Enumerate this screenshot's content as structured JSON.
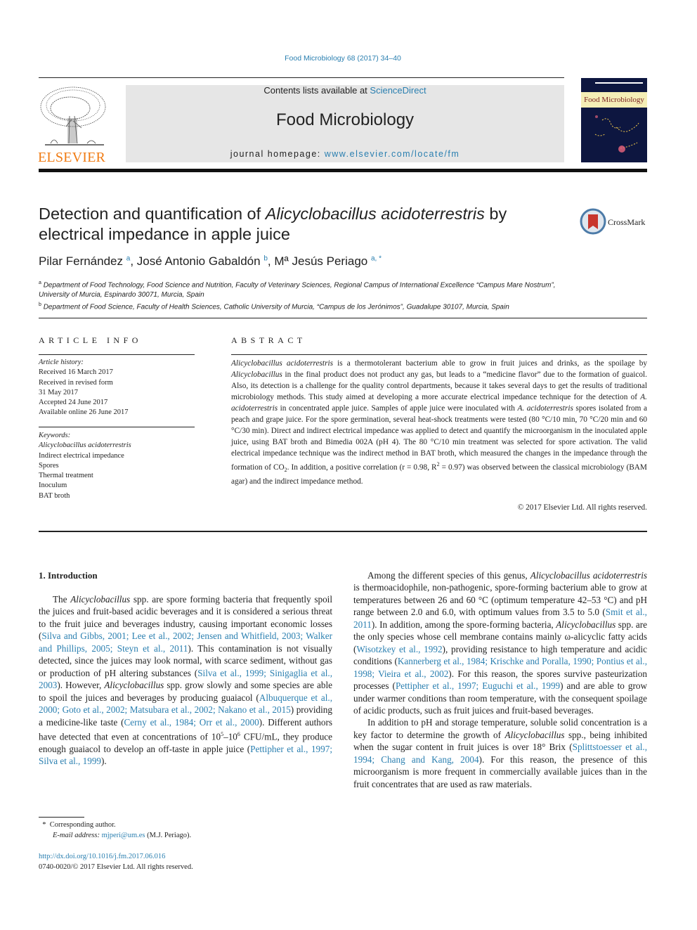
{
  "header": {
    "journal_ref": "Food Microbiology 68 (2017) 34–40",
    "contents_prefix": "Contents lists available at ",
    "contents_link": "ScienceDirect",
    "journal_name": "Food Microbiology",
    "homepage_prefix": "journal homepage: ",
    "homepage_link": "www.elsevier.com/locate/fm",
    "publisher_logo_text": "ELSEVIER",
    "cover_title": "Food Microbiology",
    "brand_color": "#f07b13",
    "link_color": "#2a7fb0"
  },
  "article": {
    "title_part1": "Detection and quantification of ",
    "title_italic": "Alicyclobacillus acidoterrestris",
    "title_part2": " by electrical impedance in apple juice",
    "crossmark_label": "CrossMark",
    "authors": [
      {
        "name": "Pilar Fernández",
        "aff": "a"
      },
      {
        "name": "José Antonio Gabaldón",
        "aff": "b"
      },
      {
        "name": "Mª Jesús Periago",
        "aff": "a, *"
      }
    ],
    "affiliations": [
      {
        "mark": "a",
        "text": "Department of Food Technology, Food Science and Nutrition, Faculty of Veterinary Sciences, Regional Campus of International Excellence “Campus Mare Nostrum”, University of Murcia, Espinardo 30071, Murcia, Spain"
      },
      {
        "mark": "b",
        "text": "Department of Food Science, Faculty of Health Sciences, Catholic University of Murcia, “Campus de los Jerónimos”, Guadalupe 30107, Murcia, Spain"
      }
    ]
  },
  "article_info": {
    "heading": "ARTICLE INFO",
    "history_label": "Article history:",
    "history": [
      "Received 16 March 2017",
      "Received in revised form",
      "31 May 2017",
      "Accepted 24 June 2017",
      "Available online 26 June 2017"
    ],
    "keywords_label": "Keywords:",
    "keywords": [
      "Alicyclobacillus acidoterrestris",
      "Indirect electrical impedance",
      "Spores",
      "Thermal treatment",
      "Inoculum",
      "BAT broth"
    ]
  },
  "abstract": {
    "heading": "ABSTRACT",
    "segments": [
      {
        "t": "Alicyclobacillus acidoterrestris",
        "i": true
      },
      {
        "t": " is a thermotolerant bacterium able to grow in fruit juices and drinks, as the spoilage by "
      },
      {
        "t": "Alicyclobacillus",
        "i": true
      },
      {
        "t": " in the final product does not product any gas, but leads to a “medicine flavor” due to the formation of guaicol. Also, its detection is a challenge for the quality control departments, because it takes several days to get the results of traditional microbiology methods. This study aimed at developing a more accurate electrical impedance technique for the detection of "
      },
      {
        "t": "A. acidoterrestris",
        "i": true
      },
      {
        "t": " in concentrated apple juice. Samples of apple juice were inoculated with "
      },
      {
        "t": "A. acidoterrestris",
        "i": true
      },
      {
        "t": " spores isolated from a peach and grape juice. For the spore germination, several heat-shock treatments were tested (80 °C/10 min, 70 °C/20 min and 60 °C/30 min). Direct and indirect electrical impedance was applied to detect and quantify the microorganism in the inoculated apple juice, using BAT broth and Bimedia 002A (pH 4). The 80 °C/10 min treatment was selected for spore activation. The valid electrical impedance technique was the indirect method in BAT broth, which measured the changes in the impedance through the formation of CO"
      },
      {
        "t": "2",
        "sub": true
      },
      {
        "t": ". In addition, a positive correlation (r = 0.98, R"
      },
      {
        "t": "2",
        "sup": true
      },
      {
        "t": " = 0.97) was observed between the classical microbiology (BAM agar) and the indirect impedance method."
      }
    ],
    "copyright": "© 2017 Elsevier Ltd. All rights reserved."
  },
  "body": {
    "section_heading": "1.  Introduction",
    "left_paragraphs": [
      [
        {
          "t": "The "
        },
        {
          "t": "Alicyclobacillus",
          "i": true
        },
        {
          "t": " spp. are spore forming bacteria that frequently spoil the juices and fruit-based acidic beverages and it is considered a serious threat to the fruit juice and beverages industry, causing important economic losses ("
        },
        {
          "t": "Silva and Gibbs, 2001; Lee et al., 2002; Jensen and Whitfield, 2003; Walker and Phillips, 2005; Steyn et al., 2011",
          "l": true
        },
        {
          "t": "). This contamination is not visually detected, since the juices may look normal, with scarce sediment, without gas or production of pH altering substances ("
        },
        {
          "t": "Silva et al., 1999; Sinigaglia et al., 2003",
          "l": true
        },
        {
          "t": "). However, "
        },
        {
          "t": "Alicyclobacillus",
          "i": true
        },
        {
          "t": " spp. grow slowly and some species are able to spoil the juices and beverages by producing guaiacol ("
        },
        {
          "t": "Albuquerque et al., 2000; Goto et al., 2002; Matsubara et al., 2002; Nakano et al., 2015",
          "l": true
        },
        {
          "t": ") providing a medicine-like taste ("
        },
        {
          "t": "Cerny et al., 1984; Orr et al., 2000",
          "l": true
        },
        {
          "t": "). Different authors have detected that even at concentrations of 10"
        },
        {
          "t": "5",
          "sup": true
        },
        {
          "t": "–10"
        },
        {
          "t": "6",
          "sup": true
        },
        {
          "t": " CFU/mL, they produce enough guaiacol to develop an off-taste in apple juice ("
        },
        {
          "t": "Pettipher et al., 1997; Silva et al., 1999",
          "l": true
        },
        {
          "t": ")."
        }
      ]
    ],
    "right_paragraphs": [
      [
        {
          "t": "Among the different species of this genus, "
        },
        {
          "t": "Alicyclobacillus acidoterrestris",
          "i": true
        },
        {
          "t": " is thermoacidophile, non-pathogenic, spore-forming bacterium able to grow at temperatures between 26 and 60 °C (optimum temperature 42–53 °C) and pH range between 2.0 and 6.0, with optimum values from 3.5 to 5.0 ("
        },
        {
          "t": "Smit et al., 2011",
          "l": true
        },
        {
          "t": "). In addition, among the spore-forming bacteria, "
        },
        {
          "t": "Alicyclobacillus",
          "i": true
        },
        {
          "t": " spp. are the only species whose cell membrane contains mainly ω-alicyclic fatty acids ("
        },
        {
          "t": "Wisotzkey et al., 1992",
          "l": true
        },
        {
          "t": "), providing resistance to high temperature and acidic conditions ("
        },
        {
          "t": "Kannerberg et al., 1984; Krischke and Poralla, 1990; Pontius et al., 1998; Vieira et al., 2002",
          "l": true
        },
        {
          "t": "). For this reason, the spores survive pasteurization processes ("
        },
        {
          "t": "Pettipher et al., 1997; Euguchi et al., 1999",
          "l": true
        },
        {
          "t": ") and are able to grow under warmer conditions than room temperature, with the consequent spoilage of acidic products, such as fruit juices and fruit-based beverages."
        }
      ],
      [
        {
          "t": "In addition to pH and storage temperature, soluble solid concentration is a key factor to determine the growth of "
        },
        {
          "t": "Alicyclobacillus",
          "i": true
        },
        {
          "t": " spp., being inhibited when the sugar content in fruit juices is over 18° Brix ("
        },
        {
          "t": "Splittstoesser et al., 1994; Chang and Kang, 2004",
          "l": true
        },
        {
          "t": "). For this reason, the presence of this microorganism is more frequent in commercially available juices than in the fruit concentrates that are used as raw materials."
        }
      ]
    ]
  },
  "footnotes": {
    "corresponding_mark": "*",
    "corresponding_text": "Corresponding author.",
    "email_label": "E-mail address:",
    "email": "mjperi@um.es",
    "email_owner": "(M.J. Periago).",
    "doi": "http://dx.doi.org/10.1016/j.fm.2017.06.016",
    "issn_line": "0740-0020/© 2017 Elsevier Ltd. All rights reserved."
  }
}
